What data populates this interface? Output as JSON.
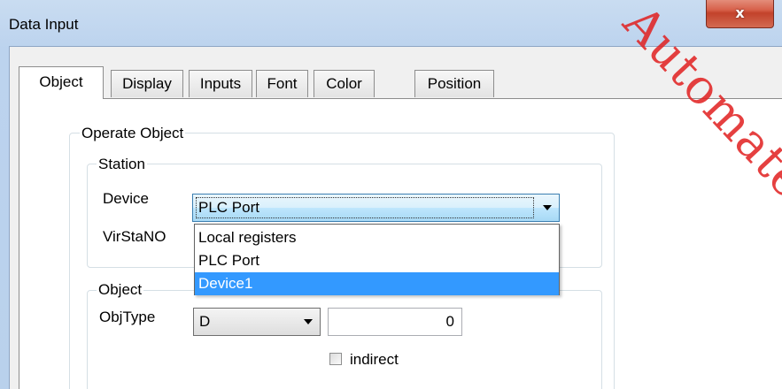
{
  "window": {
    "title": "Data Input",
    "close_glyph": "x",
    "watermark": "Automate"
  },
  "tabs": [
    {
      "label": "Object",
      "active": true
    },
    {
      "label": "Display",
      "active": false
    },
    {
      "label": "Inputs",
      "active": false
    },
    {
      "label": "Font",
      "active": false
    },
    {
      "label": "Color",
      "active": false
    },
    {
      "label": "Position",
      "active": false
    }
  ],
  "operate_object": {
    "legend": "Operate Object",
    "station": {
      "legend": "Station",
      "device_label": "Device",
      "device_value": "PLC Port",
      "virstano_label": "VirStaNO",
      "device_options": [
        "Local registers",
        "PLC Port",
        "Device1"
      ],
      "highlighted_option": "Device1"
    },
    "object": {
      "legend": "Object",
      "objtype_label": "ObjType",
      "objtype_value": "D",
      "address_value": "0",
      "indirect_label": "indirect",
      "indirect_checked": false
    }
  },
  "colors": {
    "selection": "#3399ff",
    "close_button": "#c2422b",
    "watermark": "#e11e1e"
  }
}
